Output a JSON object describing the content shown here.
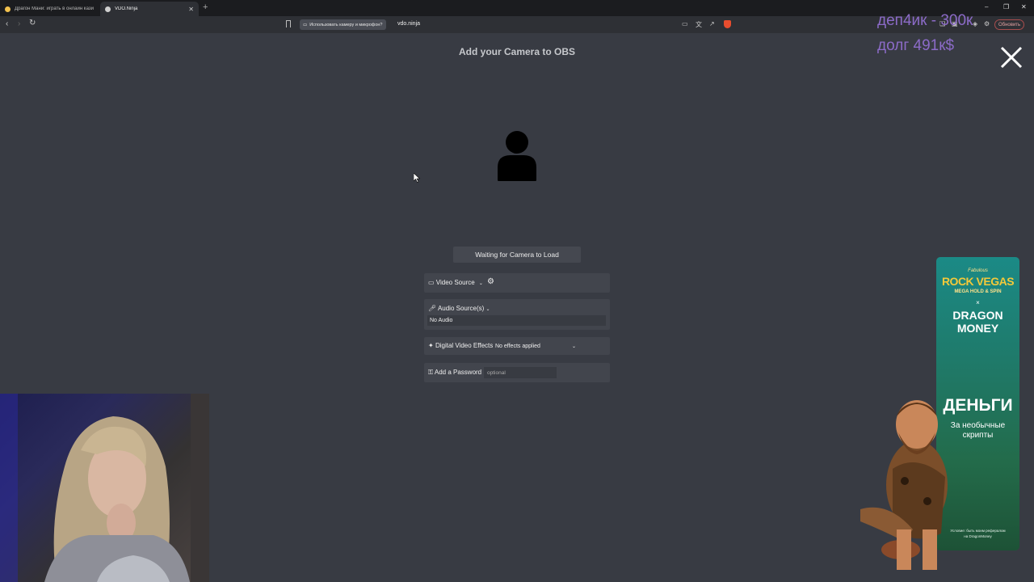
{
  "browser": {
    "tabs": [
      {
        "title": "Драгон Мани: играть в онлайн казино",
        "favicon_color": "#f2c14e"
      },
      {
        "title": "VDO.Ninja",
        "favicon_color": "#cfcfcf"
      }
    ],
    "permission_chip": "Использовать камеру и микрофон?",
    "url": "vdo.ninja",
    "update_button": "Обновить"
  },
  "stream_overlay": {
    "line1": "деп4ик - 300к",
    "line2": "долг 491к$"
  },
  "page": {
    "heading": "Add your Camera to OBS",
    "status_button": "Waiting for Camera to Load",
    "video_source_label": "Video Source",
    "audio_source_label": "Audio Source(s)",
    "audio_value": "No Audio",
    "effects_label": "Digital Video Effects",
    "effects_value": "No effects applied",
    "password_label": "Add a Password",
    "password_placeholder": "optional"
  },
  "ad": {
    "small_top": "Fabulous",
    "brand_line1": "ROCK VEGAS",
    "brand_line2": "MEGA HOLD & SPIN",
    "times": "×",
    "partner_line1": "DRAGON",
    "partner_line2": "MONEY",
    "headline": "ДЕНЬГИ",
    "sub_line1": "За необычные",
    "sub_line2": "скрипты",
    "footer_line1": "Условие: быть моим рефералом",
    "footer_line2": "на DragonMoney"
  },
  "colors": {
    "page_bg": "#383b43",
    "panel_bg": "#42454d",
    "overlay_text": "#8c6bc8",
    "ad_gold": "#f3c93a"
  }
}
